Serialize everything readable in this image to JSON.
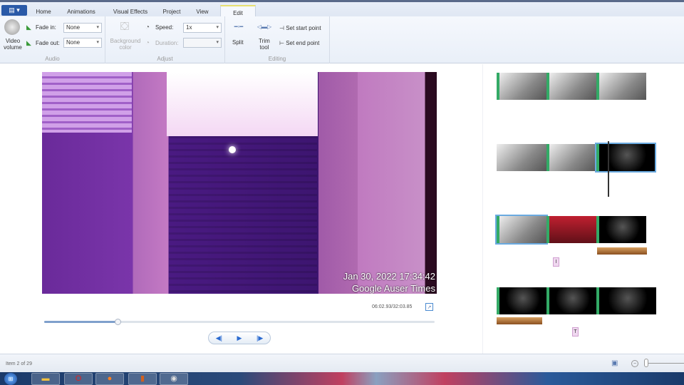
{
  "tabs": [
    "Home",
    "Animations",
    "Visual Effects",
    "Project",
    "View",
    "Edit"
  ],
  "ribbon": {
    "audio": {
      "video_volume": "Video volume",
      "fade_in": "Fade in:",
      "fade_in_value": "None",
      "fade_out": "Fade out:",
      "fade_out_value": "None",
      "label": "Audio"
    },
    "adjust": {
      "background_color": "Background color",
      "speed": "Speed:",
      "speed_value": "1x",
      "duration": "Duration:",
      "label": "Adjust"
    },
    "editing": {
      "split": "Split",
      "trim_tool": "Trim tool",
      "set_start": "Set start point",
      "set_end": "Set end point",
      "label": "Editing"
    }
  },
  "preview": {
    "timestamp_overlay": "Jan 30, 2022 17:34:42",
    "watermark_overlay": "Google Auser Times",
    "time": "06:02.93/32:03.85",
    "progress_fraction": 0.19
  },
  "storyboard": {
    "captions": [
      "I",
      "T"
    ]
  },
  "status": {
    "item": "Item 2 of 29"
  }
}
